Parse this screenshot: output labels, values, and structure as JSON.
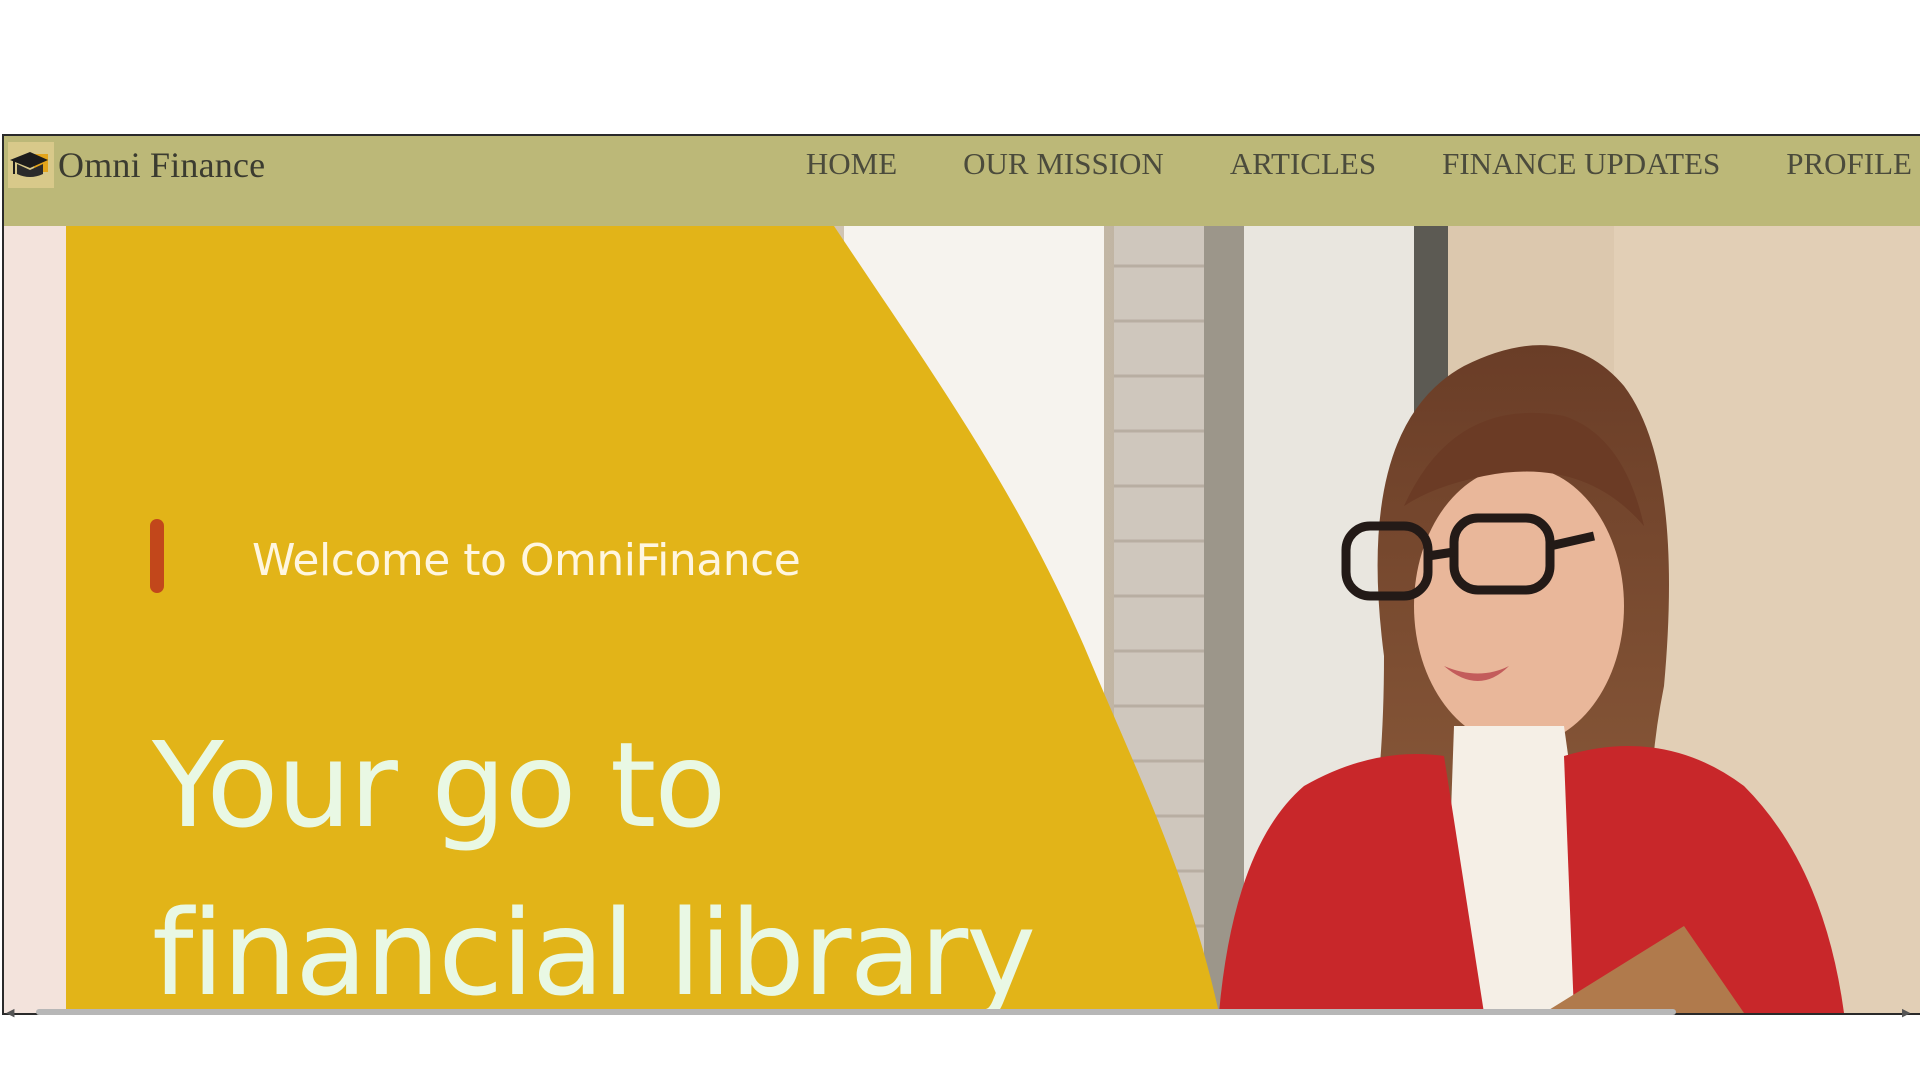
{
  "brand": {
    "name": "Omni Finance",
    "icon": "graduation-cap-icon"
  },
  "nav": {
    "items": [
      {
        "label": "HOME"
      },
      {
        "label": "OUR MISSION"
      },
      {
        "label": "ARTICLES"
      },
      {
        "label": "FINANCE UPDATES"
      },
      {
        "label": "PROFILE"
      }
    ]
  },
  "hero": {
    "welcome": "Welcome to OmniFinance",
    "headline_line1": "Your go to",
    "headline_line2": "financial library"
  },
  "colors": {
    "navbar": "#bcb878",
    "hero_panel": "#e2b418",
    "accent_bar": "#c2471b",
    "headline_text": "#e9f8e4",
    "coat": "#c8272a"
  }
}
